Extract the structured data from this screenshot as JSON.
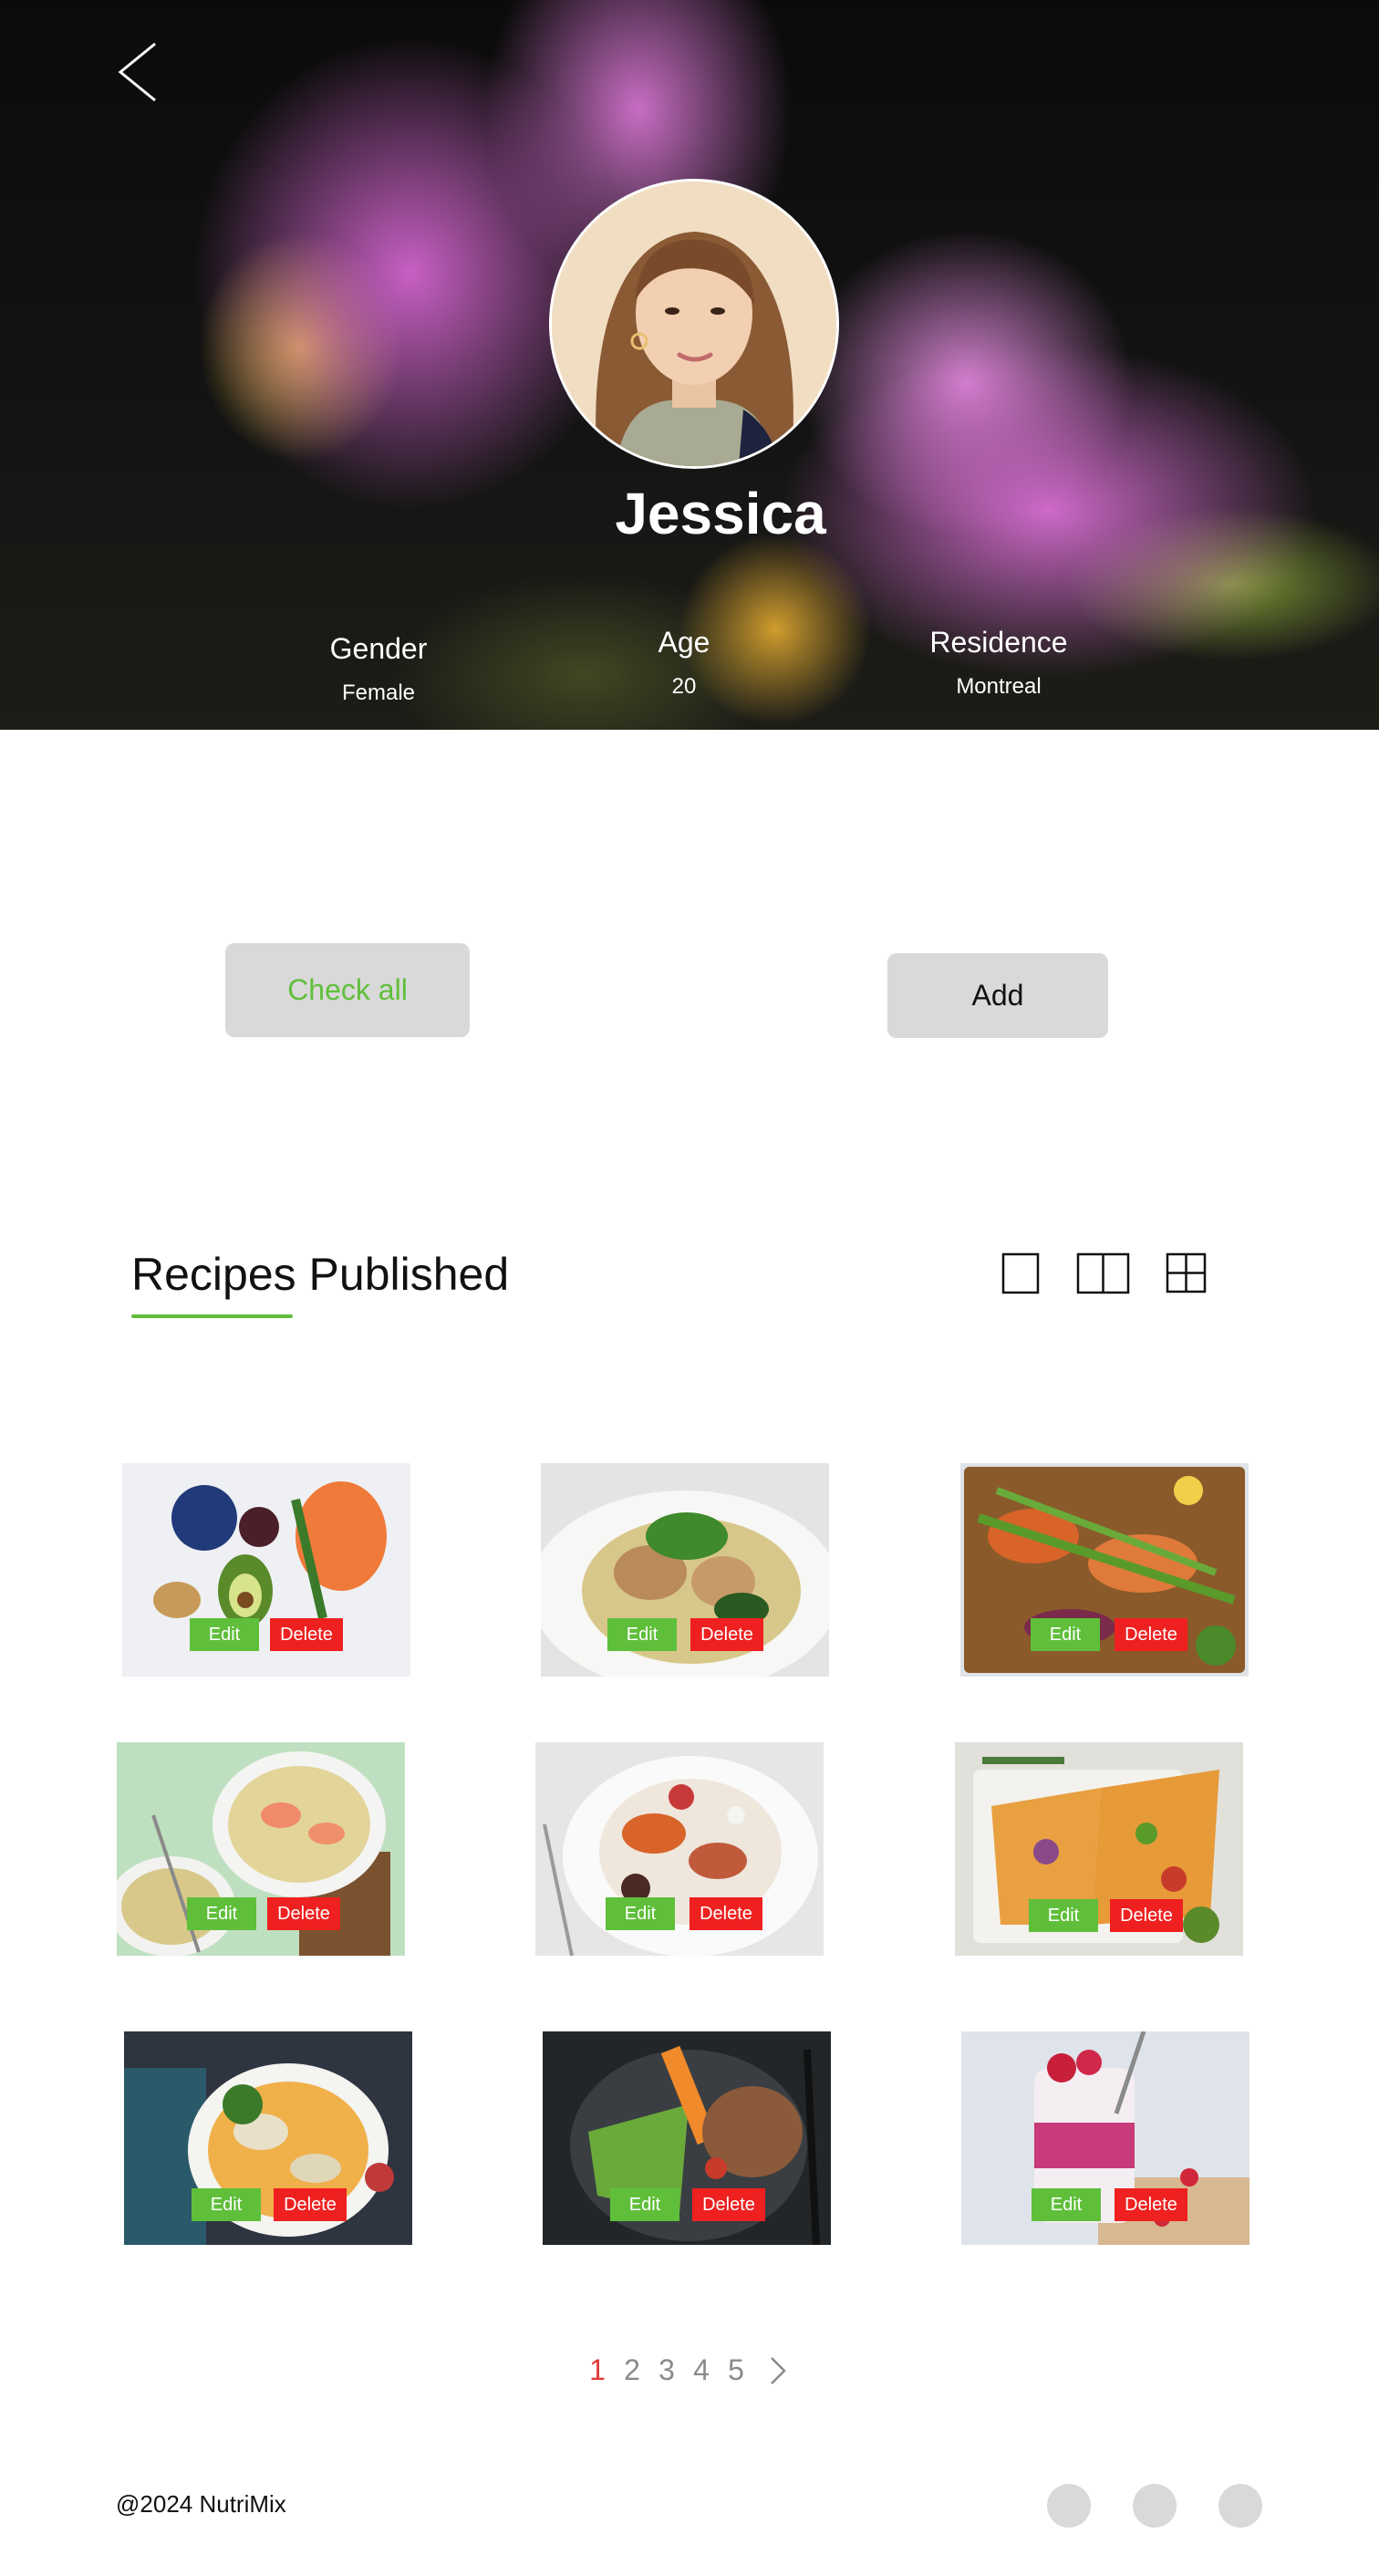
{
  "profile": {
    "name": "Jessica",
    "stats": [
      {
        "label": "Gender",
        "value": "Female"
      },
      {
        "label": "Age",
        "value": "20"
      },
      {
        "label": "Residence",
        "value": "Montreal"
      }
    ]
  },
  "actions": {
    "check_all_label": "Check all",
    "add_label": "Add"
  },
  "section": {
    "title": "Recipes Published",
    "accent_color": "#5fbf3a"
  },
  "recipes": {
    "edit_label": "Edit",
    "delete_label": "Delete",
    "items": [
      {
        "photo": "nutrient-foods"
      },
      {
        "photo": "basil-pasta"
      },
      {
        "photo": "roasted-vegetables"
      },
      {
        "photo": "shrimp-noodles"
      },
      {
        "photo": "roasted-fruit-salad"
      },
      {
        "photo": "vegetable-flatbread"
      },
      {
        "photo": "chicken-noodle-soup"
      },
      {
        "photo": "veggie-bowl"
      },
      {
        "photo": "berry-parfait"
      }
    ]
  },
  "pagination": {
    "pages": [
      "1",
      "2",
      "3",
      "4",
      "5"
    ],
    "current": "1"
  },
  "footer": {
    "copyright": "@2024 NutriMix",
    "social_count": 3
  }
}
